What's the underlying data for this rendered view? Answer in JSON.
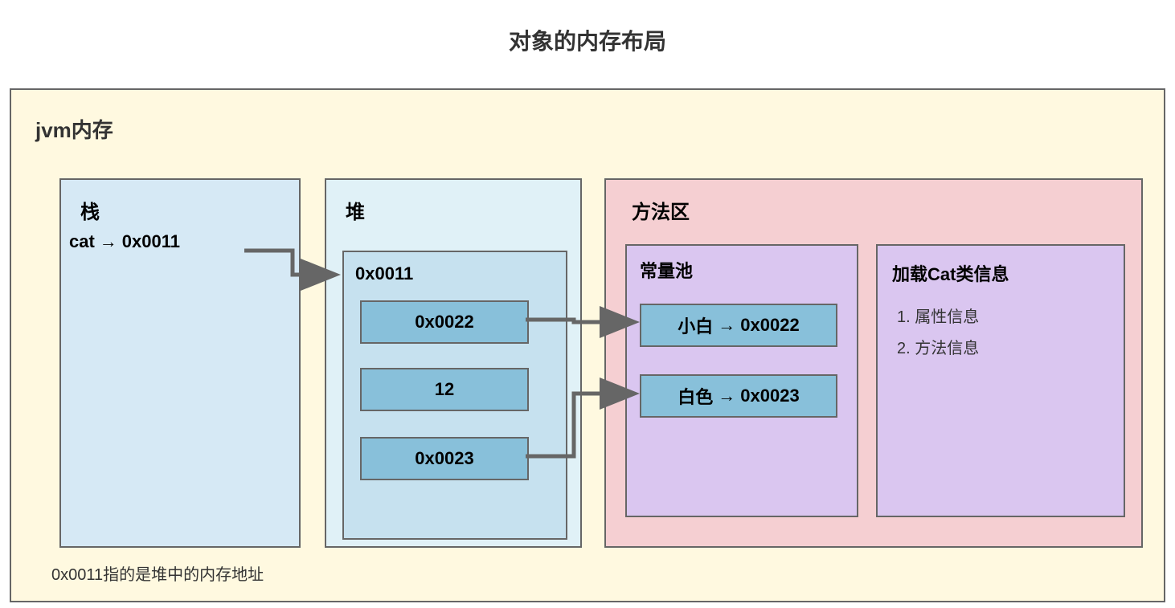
{
  "title": "对象的内存布局",
  "jvm_label": "jvm内存",
  "stack": {
    "title": "栈",
    "entry_var": "cat",
    "entry_addr": "0x0011"
  },
  "heap": {
    "title": "堆",
    "object_address": "0x0011",
    "fields": [
      "0x0022",
      "12",
      "0x0023"
    ]
  },
  "method_area": {
    "title": "方法区",
    "constant_pool": {
      "title": "常量池",
      "entries": [
        {
          "value": "小白",
          "address": "0x0022"
        },
        {
          "value": "白色",
          "address": "0x0023"
        }
      ]
    },
    "class_info": {
      "title": "加载Cat类信息",
      "items": [
        "1. 属性信息",
        "2. 方法信息"
      ]
    }
  },
  "footer_note": "0x0011指的是堆中的内存地址",
  "arrow_glyph": "→"
}
